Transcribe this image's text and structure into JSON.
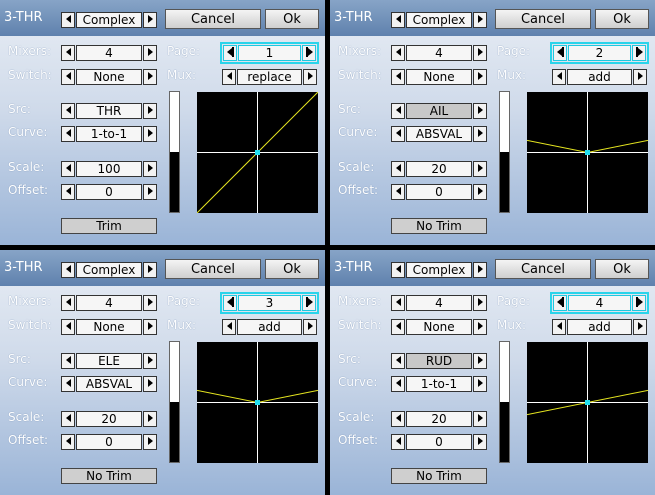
{
  "labels": {
    "mixers": "Mixers:",
    "switch": "Switch:",
    "src": "Src:",
    "curve": "Curve:",
    "scale": "Scale:",
    "offset": "Offset:",
    "page": "Page:",
    "mux": "Mux:",
    "cancel": "Cancel",
    "ok": "Ok"
  },
  "panels": [
    {
      "title": "3-THR",
      "type": "Complex",
      "mixers": "4",
      "switch": "None",
      "page": "1",
      "mux": "replace",
      "src": "THR",
      "curve": "1-to-1",
      "scale": "100",
      "offset": "0",
      "trim": "Trim",
      "src_disabled": false,
      "bar_level": 0.5,
      "curve_kind": "linear",
      "scale_frac": 1.0
    },
    {
      "title": "3-THR",
      "type": "Complex",
      "mixers": "4",
      "switch": "None",
      "page": "2",
      "mux": "add",
      "src": "AIL",
      "curve": "ABSVAL",
      "scale": "20",
      "offset": "0",
      "trim": "No Trim",
      "src_disabled": true,
      "bar_level": 0.5,
      "curve_kind": "absval",
      "scale_frac": 0.2
    },
    {
      "title": "3-THR",
      "type": "Complex",
      "mixers": "4",
      "switch": "None",
      "page": "3",
      "mux": "add",
      "src": "ELE",
      "curve": "ABSVAL",
      "scale": "20",
      "offset": "0",
      "trim": "No Trim",
      "src_disabled": false,
      "bar_level": 0.5,
      "curve_kind": "absval",
      "scale_frac": 0.2
    },
    {
      "title": "3-THR",
      "type": "Complex",
      "mixers": "4",
      "switch": "None",
      "page": "4",
      "mux": "add",
      "src": "RUD",
      "curve": "1-to-1",
      "scale": "20",
      "offset": "0",
      "trim": "No Trim",
      "src_disabled": true,
      "bar_level": 0.5,
      "curve_kind": "linear",
      "scale_frac": 0.2
    }
  ],
  "colors": {
    "curve_line": "#e6e620",
    "axis": "#ffffff",
    "center_dot": "#22e0f0",
    "page_highlight": "#2ad4ea"
  }
}
